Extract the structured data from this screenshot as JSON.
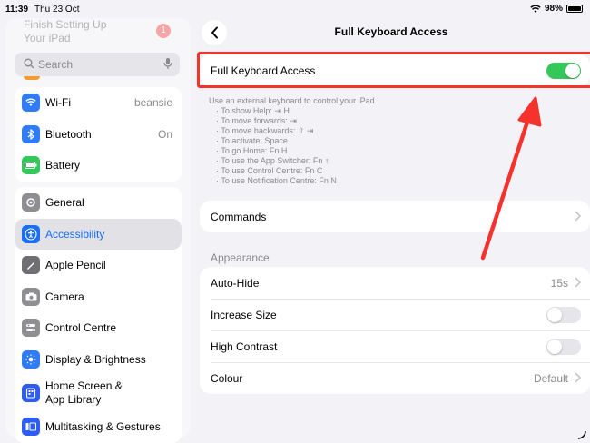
{
  "status": {
    "time": "11:39",
    "date": "Thu 23 Oct",
    "battery": "98%"
  },
  "sidebar": {
    "setup_line1": "Finish Setting Up",
    "setup_line2": "Your iPad",
    "setup_badge": "1",
    "search_placeholder": "Search",
    "items": [
      {
        "label": "Wi-Fi",
        "value": "beansie",
        "icon": "wifi-icon",
        "color": "#2f7cf6"
      },
      {
        "label": "Bluetooth",
        "value": "On",
        "icon": "bluetooth-icon",
        "color": "#2f7cf6"
      },
      {
        "label": "Battery",
        "value": "",
        "icon": "battery-icon",
        "color": "#34c759"
      },
      {
        "label": "General",
        "icon": "gear-icon",
        "color": "#8e8e93"
      },
      {
        "label": "Accessibility",
        "icon": "accessibility-icon",
        "color": "#1a6ff5"
      },
      {
        "label": "Apple Pencil",
        "icon": "pencil-icon",
        "color": "#6e6e73"
      },
      {
        "label": "Camera",
        "icon": "camera-icon",
        "color": "#8e8e93"
      },
      {
        "label": "Control Centre",
        "icon": "toggles-icon",
        "color": "#8e8e93"
      },
      {
        "label": "Display & Brightness",
        "icon": "sun-icon",
        "color": "#2f7cf6"
      },
      {
        "label_line1": "Home Screen &",
        "label_line2": "App Library",
        "icon": "home-screen-icon",
        "color": "#2f5cf6"
      },
      {
        "label": "Multitasking & Gestures",
        "icon": "multitasking-icon",
        "color": "#2f5cf6"
      }
    ]
  },
  "main": {
    "title": "Full Keyboard Access",
    "fka_label": "Full Keyboard Access",
    "fka_on": true,
    "help": [
      "Use an external keyboard to control your iPad.",
      "· To show Help: ⇥ H",
      "· To move forwards: ⇥",
      "· To move backwards: ⇧ ⇥",
      "· To activate: Space",
      "· To go Home: Fn H",
      "· To use the App Switcher: Fn ↑",
      "· To use Control Centre: Fn C",
      "· To use Notification Centre: Fn N"
    ],
    "commands_label": "Commands",
    "appearance_header": "Appearance",
    "appearance": [
      {
        "label": "Auto-Hide",
        "value": "15s"
      },
      {
        "label": "Increase Size",
        "toggle": false
      },
      {
        "label": "High Contrast",
        "toggle": false
      },
      {
        "label": "Colour",
        "value": "Default"
      }
    ]
  },
  "colors": {
    "accent": "#1a6ff5",
    "toggle_on": "#34c759",
    "annotation": "#f5332c"
  }
}
